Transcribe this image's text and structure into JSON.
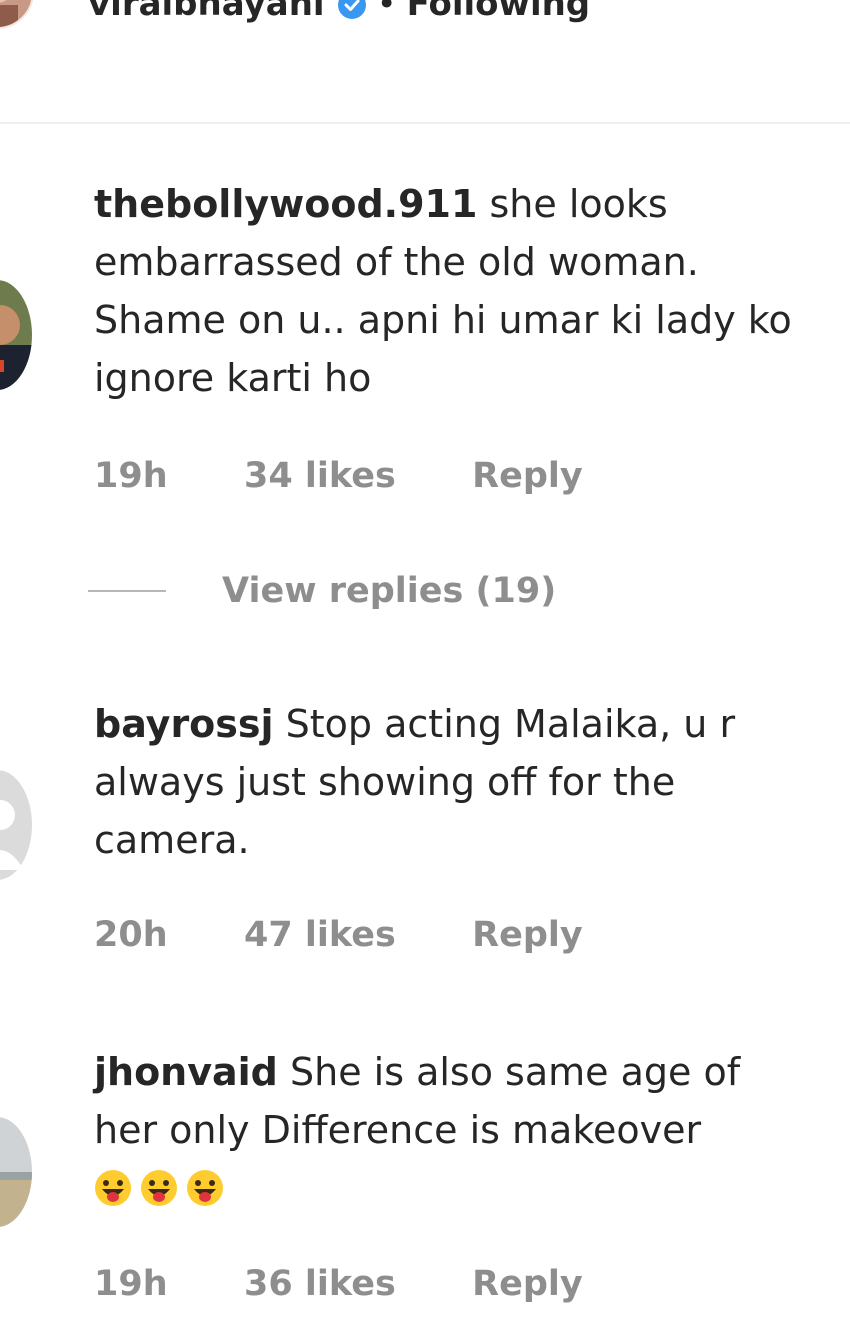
{
  "header": {
    "author": "viralbhayani",
    "verified_icon": "verified-badge-icon",
    "separator": "•",
    "follow_status": "Following"
  },
  "comments": [
    {
      "username": "thebollywood.911",
      "text": "she looks embarrassed of the old woman. Shame on u.. apni hi umar ki lady ko ignore karti ho",
      "time": "19h",
      "likes": "34 likes",
      "reply": "Reply"
    },
    {
      "username": "bayrossj",
      "text": "Stop acting Malaika, u r always just showing off for the camera.",
      "time": "20h",
      "likes": "47 likes",
      "reply": "Reply"
    },
    {
      "username": "jhonvaid",
      "text": "She is also same age of her only Difference is makeover",
      "emoji": "😛😛😛",
      "time": "19h",
      "likes": "36 likes",
      "reply": "Reply"
    }
  ],
  "view_replies": "View replies (19)",
  "colors": {
    "text": "#262626",
    "meta": "#8e8e8e",
    "divider": "#efefef",
    "verified": "#3897f0"
  }
}
